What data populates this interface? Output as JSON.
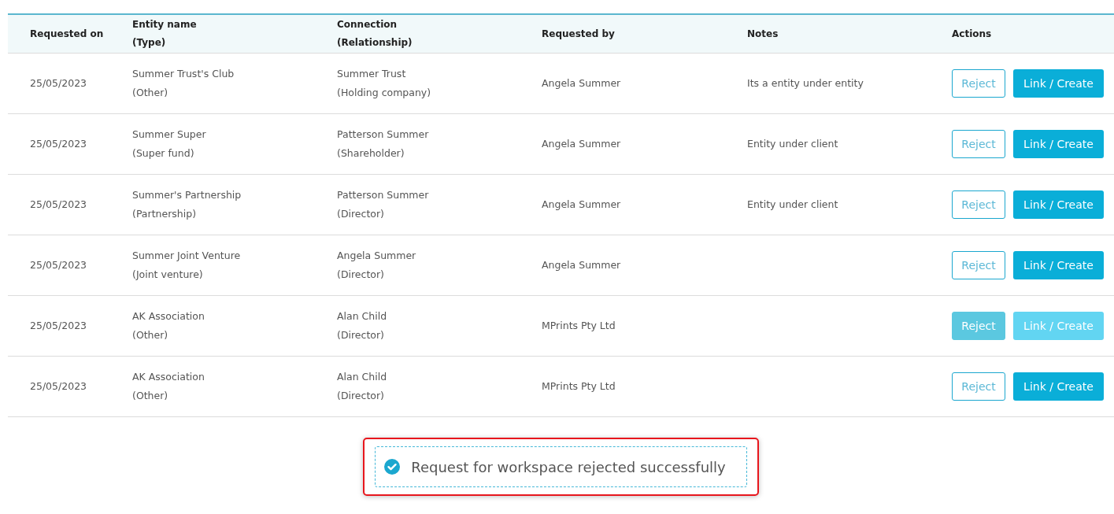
{
  "table": {
    "columns": [
      {
        "line1": "Requested on"
      },
      {
        "line1": "Entity name",
        "line2": "(Type)"
      },
      {
        "line1": "Connection",
        "line2": "(Relationship)"
      },
      {
        "line1": "Requested by"
      },
      {
        "line1": "Notes"
      },
      {
        "line1": "Actions"
      }
    ],
    "rows": [
      {
        "requested_on": "25/05/2023",
        "entity": "Summer Trust's Club",
        "type": "(Other)",
        "connection": "Summer Trust",
        "relationship": "(Holding company)",
        "requested_by": "Angela Summer",
        "notes": "Its a entity under entity",
        "reject": "Reject",
        "link": "Link / Create",
        "disabled": false
      },
      {
        "requested_on": "25/05/2023",
        "entity": "Summer Super",
        "type": "(Super fund)",
        "connection": "Patterson Summer",
        "relationship": "(Shareholder)",
        "requested_by": "Angela Summer",
        "notes": "Entity under client",
        "reject": "Reject",
        "link": "Link / Create",
        "disabled": false
      },
      {
        "requested_on": "25/05/2023",
        "entity": "Summer's Partnership",
        "type": "(Partnership)",
        "connection": "Patterson Summer",
        "relationship": "(Director)",
        "requested_by": "Angela Summer",
        "notes": "Entity under client",
        "reject": "Reject",
        "link": "Link / Create",
        "disabled": false
      },
      {
        "requested_on": "25/05/2023",
        "entity": "Summer Joint Venture",
        "type": "(Joint venture)",
        "connection": "Angela Summer",
        "relationship": "(Director)",
        "requested_by": "Angela Summer",
        "reject": "Reject",
        "link": "Link / Create",
        "disabled": false
      },
      {
        "requested_on": "25/05/2023",
        "entity": "AK Association",
        "type": "(Other)",
        "connection": "Alan Child",
        "relationship": "(Director)",
        "requested_by": "MPrints Pty Ltd",
        "reject": "Reject",
        "link": "Link / Create",
        "disabled": true
      },
      {
        "requested_on": "25/05/2023",
        "entity": "AK Association",
        "type": "(Other)",
        "connection": "Alan Child",
        "relationship": "(Director)",
        "requested_by": "MPrints Pty Ltd",
        "reject": "Reject",
        "link": "Link / Create",
        "disabled": false
      }
    ]
  },
  "toast": {
    "message": "Request for workspace rejected successfully",
    "highlighted": true
  }
}
